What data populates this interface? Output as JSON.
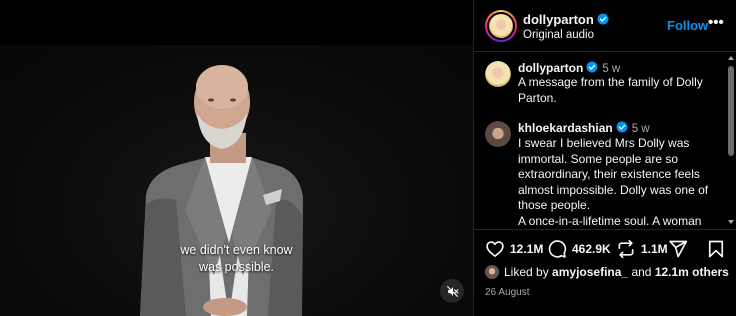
{
  "video": {
    "subtitle_line1": "we didn't even know",
    "subtitle_line2": "was possible."
  },
  "header": {
    "username": "dollyparton",
    "audio_label": "Original audio",
    "follow_label": "Follow",
    "more_label": "•••"
  },
  "comments": [
    {
      "username": "dollyparton",
      "time": "5 w",
      "text": "A message from the family of Dolly Parton."
    },
    {
      "username": "khloekardashian",
      "time": "5 w",
      "text_lines": [
        "I swear I believed Mrs Dolly was immortal. Some people are so extraordinary, their existence feels almost impossible. Dolly was one of those people.",
        "A once-in-a-lifetime soul. A woman whose light, heart, talent and"
      ]
    }
  ],
  "actions": {
    "likes_count": "12.1M",
    "comments_count": "462.9K",
    "reposts_count": "1.1M"
  },
  "likes_summary": {
    "prefix": "Liked by",
    "user": "amyjosefina_",
    "middle": "and",
    "others": "12.1m others"
  },
  "post_date": "26 August",
  "colors": {
    "accent": "#0095f6",
    "verified": "#0095f6",
    "background": "#000000",
    "divider": "#262626",
    "muted_text": "#a8a8a8"
  }
}
